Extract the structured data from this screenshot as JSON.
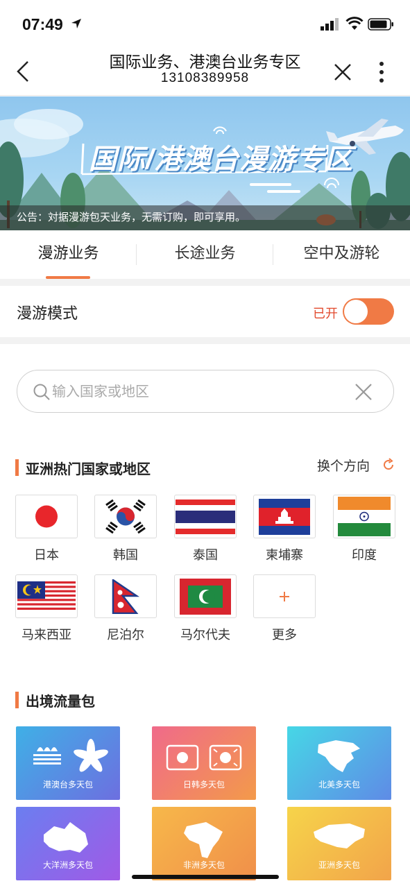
{
  "status_bar": {
    "time": "07:49"
  },
  "nav": {
    "title": "国际业务、港澳台业务专区",
    "subtitle": "13108389958"
  },
  "banner": {
    "title": "国际/港澳台漫游专区",
    "notice": "公告：対据漫游包天业务，无需订购，即可享用。"
  },
  "tabs": [
    {
      "label": "漫游业务",
      "active": true
    },
    {
      "label": "长途业务",
      "active": false
    },
    {
      "label": "空中及游轮",
      "active": false
    }
  ],
  "roaming_mode": {
    "label": "漫游模式",
    "state": "已开",
    "on": true
  },
  "search": {
    "placeholder": "输入国家或地区",
    "value": ""
  },
  "asia_section": {
    "title": "亚洲热门国家或地区",
    "switch_label": "换个方向",
    "countries": [
      {
        "name": "日本",
        "flag": "japan-flag-icon"
      },
      {
        "name": "韩国",
        "flag": "korea-flag-icon"
      },
      {
        "name": "泰国",
        "flag": "thailand-flag-icon"
      },
      {
        "name": "柬埔寨",
        "flag": "cambodia-flag-icon"
      },
      {
        "name": "印度",
        "flag": "india-flag-icon"
      },
      {
        "name": "马来西亚",
        "flag": "malaysia-flag-icon"
      },
      {
        "name": "尼泊尔",
        "flag": "nepal-flag-icon"
      },
      {
        "name": "马尔代夫",
        "flag": "maldives-flag-icon"
      },
      {
        "name": "更多",
        "flag": "plus-icon"
      }
    ]
  },
  "data_packs": {
    "title": "出境流量包",
    "items": [
      {
        "label": "港澳台多天包",
        "color_a": "#3fb0e6",
        "color_b": "#6d6fe0"
      },
      {
        "label": "日韩多天包",
        "color_a": "#f06a8a",
        "color_b": "#f39a4a"
      },
      {
        "label": "北美多天包",
        "color_a": "#46d7e6",
        "color_b": "#5f8be6"
      },
      {
        "label": "大洋洲多天包",
        "color_a": "#6b7ef0",
        "color_b": "#a05ae6"
      },
      {
        "label": "非洲多天包",
        "color_a": "#f7b84a",
        "color_b": "#f08f4a"
      },
      {
        "label": "亚洲多天包",
        "color_a": "#f6d44a",
        "color_b": "#f2a44a"
      }
    ]
  },
  "colors": {
    "accent": "#f07a45",
    "state_red": "#e24a2d"
  }
}
